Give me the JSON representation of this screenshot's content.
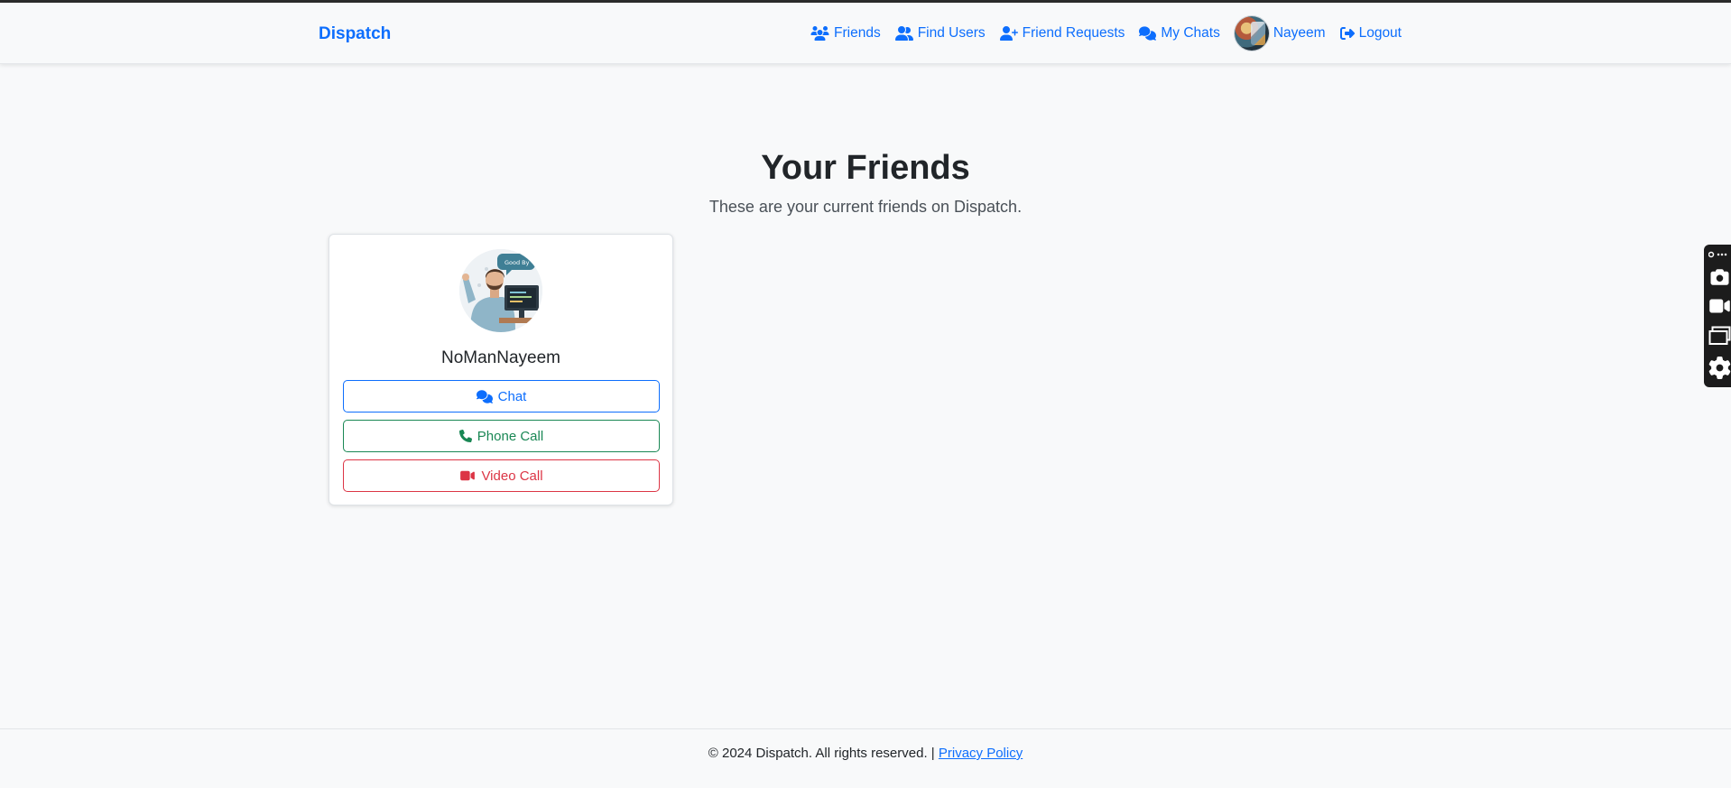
{
  "navbar": {
    "brand": "Dispatch",
    "links": {
      "friends": "Friends",
      "find_users": "Find Users",
      "friend_requests": "Friend Requests",
      "my_chats": "My Chats",
      "profile": "Nayeem",
      "logout": "Logout"
    }
  },
  "main": {
    "title": "Your Friends",
    "subtitle": "These are your current friends on Dispatch."
  },
  "friends": [
    {
      "name": "NoManNayeem",
      "avatar_caption": "Good By",
      "buttons": {
        "chat": "Chat",
        "phone": "Phone Call",
        "video": "Video Call"
      }
    }
  ],
  "footer": {
    "copyright": "© 2024 Dispatch. All rights reserved. |",
    "privacy_link": "Privacy Policy"
  },
  "icons": {
    "friends": "users-icon",
    "find_users": "user-group-icon",
    "friend_requests": "user-plus-icon",
    "my_chats": "comments-icon",
    "logout": "sign-out-icon",
    "chat": "comments-icon",
    "phone": "phone-icon",
    "video": "video-icon",
    "toolbar": [
      "link-icon",
      "camera-icon",
      "video-camera-icon",
      "windows-icon",
      "gear-icon"
    ]
  },
  "colors": {
    "primary": "#0d6efd",
    "success": "#198754",
    "danger": "#dc3545",
    "background": "#f8f9fa"
  }
}
